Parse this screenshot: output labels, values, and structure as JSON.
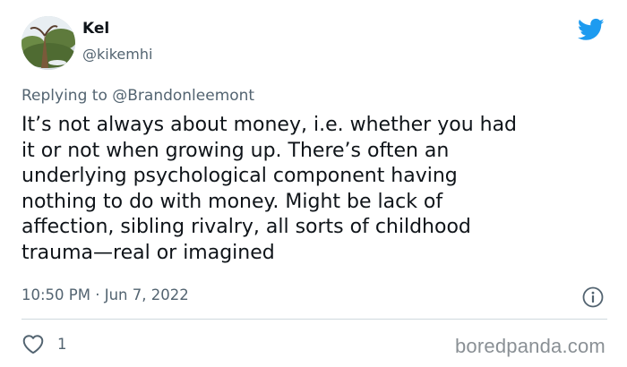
{
  "author": {
    "name": "Kel",
    "handle": "@kikemhi",
    "avatar_icon": "user-avatar-photo"
  },
  "reply": {
    "prefix": "Replying to",
    "mention": "@Brandonleemont"
  },
  "tweet": {
    "text": "It’s not always about money, i.e. whether you had\nit or not when growing up. There’s often an\nunderlying psychological component having\nnothing to do with money. Might be lack of\naffection, sibling rivalry, all sorts of childhood\ntrauma—real or imagined"
  },
  "meta": {
    "time": "10:50 PM",
    "separator": "·",
    "date": "Jun 7, 2022"
  },
  "actions": {
    "like_icon": "heart-icon",
    "like_count": "1",
    "info_icon": "info-icon"
  },
  "brand": {
    "platform_icon": "twitter-bird-icon",
    "platform_color": "#1d9bf0",
    "watermark": "boredpanda.com"
  }
}
